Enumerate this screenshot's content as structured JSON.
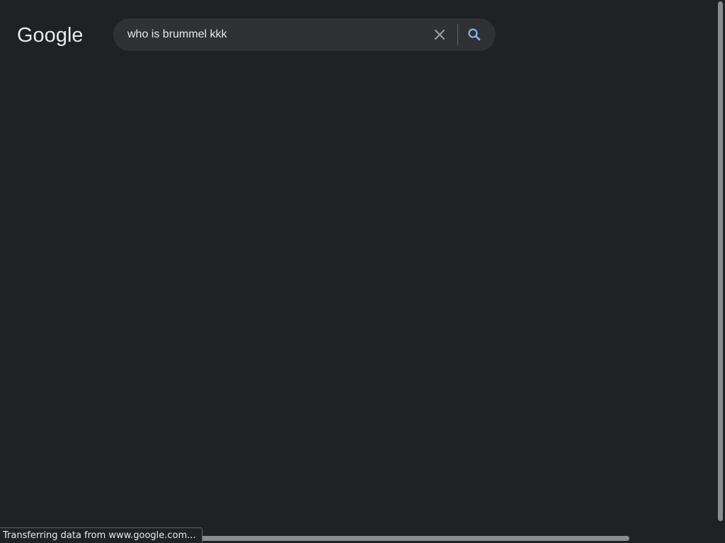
{
  "header": {
    "logo_text": "Google",
    "logo_colors": [
      "#e8eaed"
    ]
  },
  "search": {
    "query": "who is brummel kkk",
    "clear_icon": "close-icon",
    "search_icon": "search-icon",
    "search_icon_color": "#8ab4f8",
    "clear_icon_color": "#9aa0a6"
  },
  "status_bar": {
    "text": "Transferring data from www.google.com..."
  },
  "theme": {
    "background": "#202124",
    "searchbar_background": "#303134",
    "text": "#e8eaed"
  }
}
